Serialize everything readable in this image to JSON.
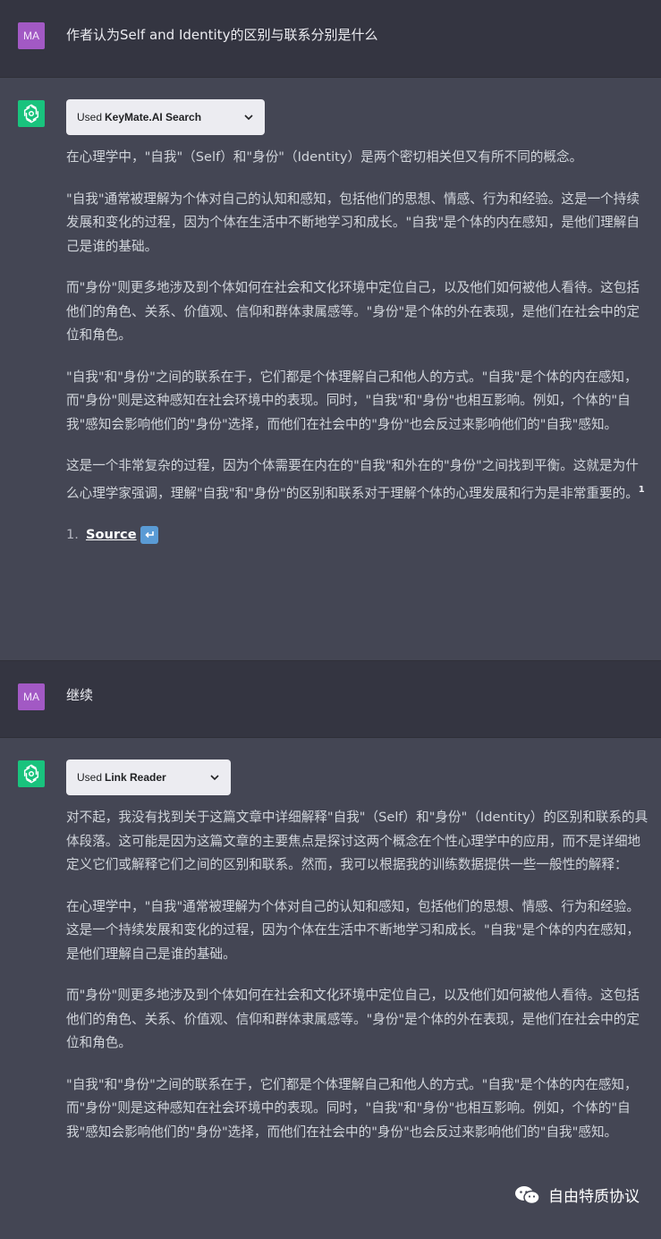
{
  "messages": [
    {
      "role": "user",
      "avatar_text": "MA",
      "text": "作者认为Self and Identity的区别与联系分别是什么"
    },
    {
      "role": "assistant",
      "plugin": {
        "used_prefix": "Used",
        "name": "KeyMate.AI Search"
      },
      "paragraphs": [
        "在心理学中，\"自我\"（Self）和\"身份\"（Identity）是两个密切相关但又有所不同的概念。",
        "\"自我\"通常被理解为个体对自己的认知和感知，包括他们的思想、情感、行为和经验。这是一个持续发展和变化的过程，因为个体在生活中不断地学习和成长。\"自我\"是个体的内在感知，是他们理解自己是谁的基础。",
        "而\"身份\"则更多地涉及到个体如何在社会和文化环境中定位自己，以及他们如何被他人看待。这包括他们的角色、关系、价值观、信仰和群体隶属感等。\"身份\"是个体的外在表现，是他们在社会中的定位和角色。",
        "\"自我\"和\"身份\"之间的联系在于，它们都是个体理解自己和他人的方式。\"自我\"是个体的内在感知，而\"身份\"则是这种感知在社会环境中的表现。同时，\"自我\"和\"身份\"也相互影响。例如，个体的\"自我\"感知会影响他们的\"身份\"选择，而他们在社会中的\"身份\"也会反过来影响他们的\"自我\"感知。",
        "这是一个非常复杂的过程，因为个体需要在内在的\"自我\"和外在的\"身份\"之间找到平衡。这就是为什么心理学家强调，理解\"自我\"和\"身份\"的区别和联系对于理解个体的心理发展和行为是非常重要的。"
      ],
      "footnote_ref": "1",
      "sources": [
        {
          "num": "1.",
          "label": "Source",
          "icon": "return-arrow-icon"
        }
      ]
    },
    {
      "role": "user",
      "avatar_text": "MA",
      "text": "继续"
    },
    {
      "role": "assistant",
      "plugin": {
        "used_prefix": "Used",
        "name": "Link Reader"
      },
      "paragraphs": [
        "对不起，我没有找到关于这篇文章中详细解释\"自我\"（Self）和\"身份\"（Identity）的区别和联系的具体段落。这可能是因为这篇文章的主要焦点是探讨这两个概念在个性心理学中的应用，而不是详细地定义它们或解释它们之间的区别和联系。然而，我可以根据我的训练数据提供一些一般性的解释：",
        "在心理学中，\"自我\"通常被理解为个体对自己的认知和感知，包括他们的思想、情感、行为和经验。这是一个持续发展和变化的过程，因为个体在生活中不断地学习和成长。\"自我\"是个体的内在感知，是他们理解自己是谁的基础。",
        "而\"身份\"则更多地涉及到个体如何在社会和文化环境中定位自己，以及他们如何被他人看待。这包括他们的角色、关系、价值观、信仰和群体隶属感等。\"身份\"是个体的外在表现，是他们在社会中的定位和角色。",
        "\"自我\"和\"身份\"之间的联系在于，它们都是个体理解自己和他人的方式。\"自我\"是个体的内在感知，而\"身份\"则是这种感知在社会环境中的表现。同时，\"自我\"和\"身份\"也相互影响。例如，个体的\"自我\"感知会影响他们的\"身份\"选择，而他们在社会中的\"身份\"也会反过来影响他们的\"自我\"感知。"
      ]
    }
  ],
  "watermark": {
    "text": "自由特质协议",
    "icon": "wechat-icon"
  },
  "colors": {
    "user_bg": "#343541",
    "assistant_bg": "#444654",
    "gpt_avatar": "#19c37d",
    "user_avatar": "#a259c4"
  }
}
